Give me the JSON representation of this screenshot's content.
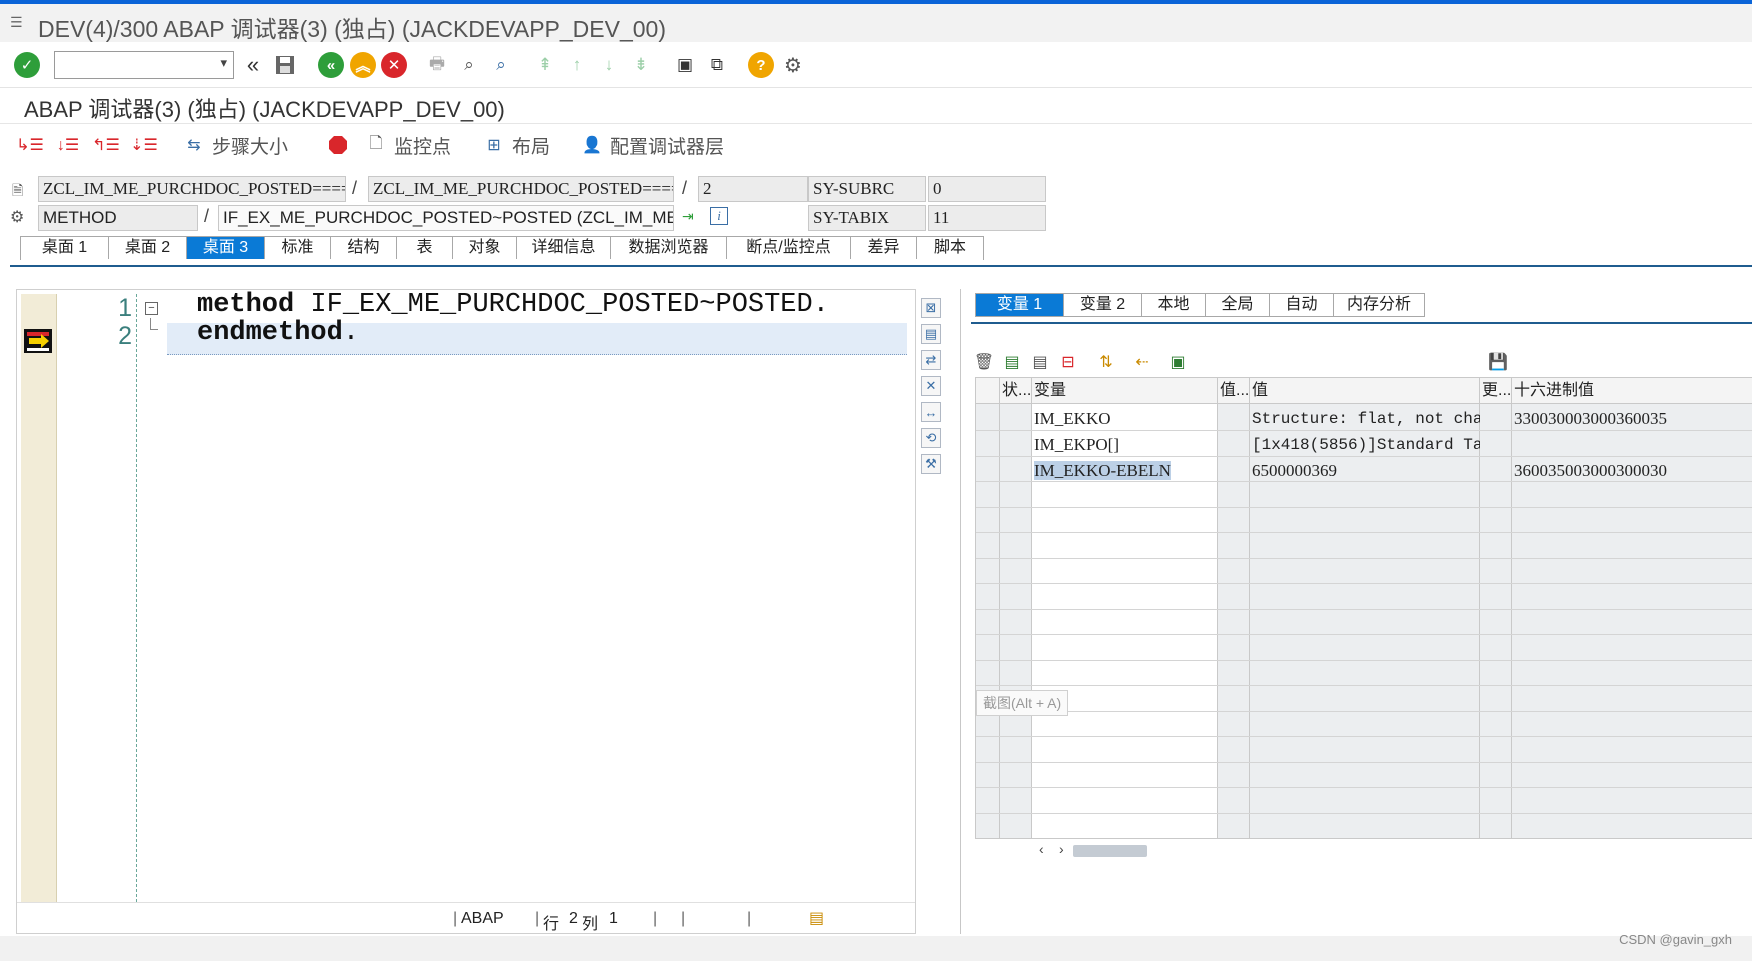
{
  "window": {
    "title": "DEV(4)/300 ABAP 调试器(3) (独占) (JACKDEVAPP_DEV_00)"
  },
  "toolbar": {
    "command_value": "",
    "icons": [
      "enter-icon",
      "back-icon",
      "save-icon",
      "back-green-icon",
      "exit-yellow-icon",
      "cancel-red-icon",
      "print-icon",
      "find-icon",
      "find-next-icon",
      "first-page-icon",
      "prev-page-icon",
      "next-page-icon",
      "last-page-icon",
      "create-session-icon",
      "shortcut-icon",
      "help-icon",
      "settings-icon"
    ]
  },
  "debugger": {
    "title": "ABAP 调试器(3)  (独占) (JACKDEVAPP_DEV_00)"
  },
  "apptoolbar": {
    "step_size_label": "步骤大小",
    "watchpoint_label": "监控点",
    "layout_label": "布局",
    "config_label": "配置调试器层"
  },
  "info": {
    "program": "ZCL_IM_ME_PURCHDOC_POSTED====...",
    "include": "ZCL_IM_ME_PURCHDOC_POSTED====...",
    "line": "2",
    "subrc_label": "SY-SUBRC",
    "subrc_value": "0",
    "event_type": "METHOD",
    "event": "IF_EX_ME_PURCHDOC_POSTED~POSTED (ZCL_IM_ME_PUR...",
    "tabix_label": "SY-TABIX",
    "tabix_value": "11"
  },
  "desk_tabs": [
    "桌面 1",
    "桌面 2",
    "桌面 3",
    "标准",
    "结构",
    "表",
    "对象",
    "详细信息",
    "数据浏览器",
    "断点/监控点",
    "差异",
    "脚本"
  ],
  "editor": {
    "line1_no": "1",
    "line2_no": "2",
    "line1_kw": "method",
    "line1_rest": " IF_EX_ME_PURCHDOC_POSTED~POSTED.",
    "line2_kw": "endmethod",
    "line2_rest": ".",
    "status_lang": "ABAP",
    "status_row_label": "行",
    "status_row": "2",
    "status_col_label": "列",
    "status_col": "1"
  },
  "var_tabs": [
    "变量 1",
    "变量 2",
    "本地",
    "全局",
    "自动",
    "内存分析"
  ],
  "grid": {
    "headers": [
      "状...",
      "变量",
      "值...",
      "值",
      "更...",
      "十六进制值"
    ],
    "rows": [
      {
        "name": "IM_EKKO",
        "value": "Structure: flat, not cha…",
        "hex": "330030003000360035"
      },
      {
        "name": "IM_EKPO[]",
        "value": "[1x418(5856)]Standard Ta…",
        "hex": ""
      },
      {
        "name": "IM_EKKO-EBELN",
        "value": "6500000369",
        "hex": "360035003000300030"
      }
    ]
  },
  "tooltip": "截图(Alt + A)",
  "watermark": "CSDN @gavin_gxh"
}
